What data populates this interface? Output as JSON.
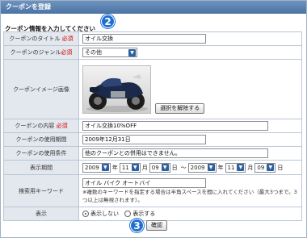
{
  "window": {
    "title": "クーポンを登録"
  },
  "section_label": "クーポン情報を入力してください",
  "badges": {
    "step2": "2",
    "step3": "3"
  },
  "required_mark": "必須",
  "fields": {
    "title": {
      "label": "クーポンのタイトル",
      "value": "オイル交換"
    },
    "genre": {
      "label": "クーポンのジャンル",
      "value": "その他"
    },
    "image": {
      "label": "クーポンイメージ画像",
      "remove_button": "選択を解除する",
      "image_icon": "motorcycle-photo"
    },
    "content": {
      "label": "クーポンの内容",
      "value": "オイル交換10%OFF"
    },
    "period": {
      "label": "クーポンの使用期間",
      "value": "2009年12月31日"
    },
    "conditions": {
      "label": "クーポンの使用条件",
      "value": "他のクーポンとの併用はできません。"
    },
    "display_period": {
      "label": "表示期間",
      "from": {
        "year": "2009",
        "month": "11",
        "day": "09"
      },
      "to": {
        "year": "2009",
        "month": "11",
        "day": "09"
      },
      "year_unit": "年",
      "month_unit": "月",
      "day_unit": "日",
      "tilde": "〜"
    },
    "keywords": {
      "label": "検索用キーワード",
      "value": "オイル バイク オートバイ",
      "note": "※複数のキーワードを指定する場合は半角スペースを間に入れてください（最大3つまで。3つ以上は無視されます）。"
    },
    "display": {
      "label": "表示",
      "option_hide": "表示しない",
      "option_show": "表示する",
      "selected": "表示しない"
    }
  },
  "confirm_button": "確認",
  "colors": {
    "titlebar": "#4a73a4",
    "label_bg": "#e3e8ee",
    "required": "#d40000",
    "badge": "#1f6fd1"
  }
}
